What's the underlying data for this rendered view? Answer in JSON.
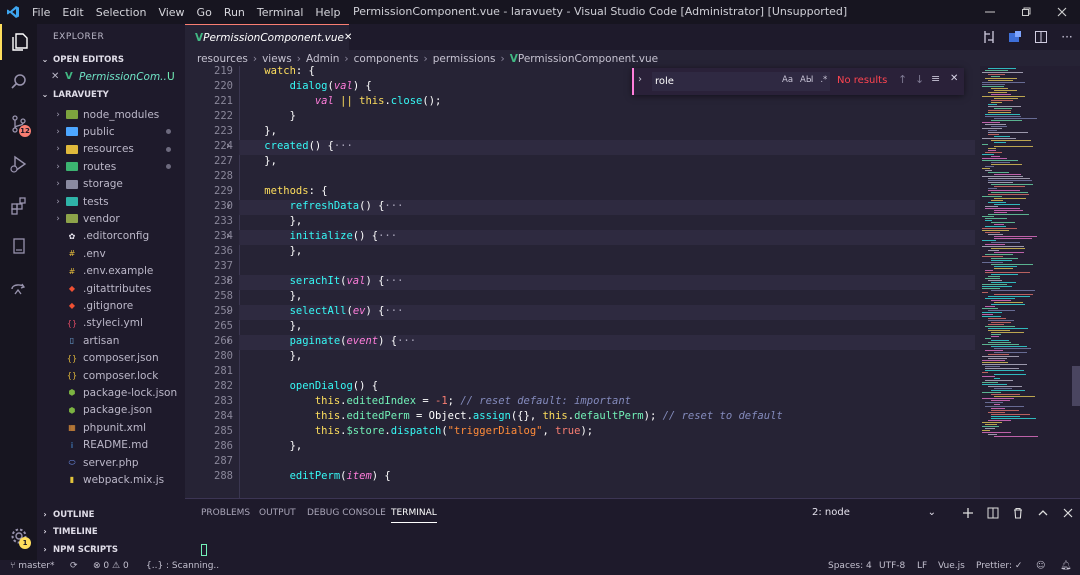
{
  "titlebar": {
    "menu": [
      "File",
      "Edit",
      "Selection",
      "View",
      "Go",
      "Run",
      "Terminal",
      "Help"
    ],
    "title": "PermissionComponent.vue - laravuety - Visual Studio Code [Administrator] [Unsupported]"
  },
  "activity": {
    "source_control_badge": "12",
    "accounts_badge": "1"
  },
  "sidebar": {
    "title": "EXPLORER",
    "open_editors_label": "OPEN EDITORS",
    "open_editor": {
      "name": "PermissionCom...",
      "status": "U"
    },
    "project_label": "LARAVUETY",
    "items": [
      {
        "name": "node_modules",
        "kind": "folder",
        "color": "#7ca33e"
      },
      {
        "name": "public",
        "kind": "folder",
        "color": "#4da6ff"
      },
      {
        "name": "resources",
        "kind": "folder",
        "color": "#e0b93c"
      },
      {
        "name": "routes",
        "kind": "folder",
        "color": "#3cb371"
      },
      {
        "name": "storage",
        "kind": "folder",
        "color": "#8a8aa0"
      },
      {
        "name": "tests",
        "kind": "folder",
        "color": "#2fb3a8"
      },
      {
        "name": "vendor",
        "kind": "folder",
        "color": "#8da34a"
      },
      {
        "name": ".editorconfig",
        "kind": "file",
        "glyph": "✿",
        "color": "#e9e6f0"
      },
      {
        "name": ".env",
        "kind": "file",
        "glyph": "#",
        "color": "#e2b93b"
      },
      {
        "name": ".env.example",
        "kind": "file",
        "glyph": "#",
        "color": "#e2b93b"
      },
      {
        "name": ".gitattributes",
        "kind": "file",
        "glyph": "◆",
        "color": "#f05033"
      },
      {
        "name": ".gitignore",
        "kind": "file",
        "glyph": "◆",
        "color": "#f05033"
      },
      {
        "name": ".styleci.yml",
        "kind": "file",
        "glyph": "{}",
        "color": "#e44c65"
      },
      {
        "name": "artisan",
        "kind": "file",
        "glyph": "▯",
        "color": "#6fa8dc"
      },
      {
        "name": "composer.json",
        "kind": "file",
        "glyph": "{}",
        "color": "#e2b93b"
      },
      {
        "name": "composer.lock",
        "kind": "file",
        "glyph": "{}",
        "color": "#e2b93b"
      },
      {
        "name": "package-lock.json",
        "kind": "file",
        "glyph": "⬢",
        "color": "#7cb342"
      },
      {
        "name": "package.json",
        "kind": "file",
        "glyph": "⬢",
        "color": "#7cb342"
      },
      {
        "name": "phpunit.xml",
        "kind": "file",
        "glyph": "▦",
        "color": "#e8963a"
      },
      {
        "name": "README.md",
        "kind": "file",
        "glyph": "i",
        "color": "#4ea1f3"
      },
      {
        "name": "server.php",
        "kind": "file",
        "glyph": "⬭",
        "color": "#6d8ee8"
      },
      {
        "name": "webpack.mix.js",
        "kind": "file",
        "glyph": "▮",
        "color": "#e2c43b"
      }
    ],
    "bottom_sections": [
      "OUTLINE",
      "TIMELINE",
      "NPM SCRIPTS"
    ]
  },
  "tab": {
    "label": "PermissionComponent.vue"
  },
  "breadcrumb": [
    "resources",
    "views",
    "Admin",
    "components",
    "permissions",
    "PermissionComponent.vue"
  ],
  "find": {
    "query": "role",
    "opt_case": "Aa",
    "opt_word": "AЫ",
    "opt_regex": ".*",
    "result": "No results"
  },
  "editor": {
    "lines": [
      {
        "n": "219",
        "tokens": [
          [
            "pt",
            "    "
          ],
          [
            "kw",
            "watch"
          ],
          [
            "pt",
            ": {"
          ]
        ]
      },
      {
        "n": "220",
        "tokens": [
          [
            "pt",
            "        "
          ],
          [
            "fn",
            "dialog"
          ],
          [
            "pt",
            "("
          ],
          [
            "pm",
            "val"
          ],
          [
            "pt",
            ") {"
          ]
        ]
      },
      {
        "n": "221",
        "tokens": [
          [
            "pt",
            "            "
          ],
          [
            "pm",
            "val"
          ],
          [
            "pt",
            " "
          ],
          [
            "kw",
            "||"
          ],
          [
            "pt",
            " "
          ],
          [
            "kw",
            "this"
          ],
          [
            "pt",
            "."
          ],
          [
            "fn",
            "close"
          ],
          [
            "pt",
            "();"
          ]
        ]
      },
      {
        "n": "222",
        "tokens": [
          [
            "pt",
            "        }"
          ]
        ]
      },
      {
        "n": "223",
        "tokens": [
          [
            "pt",
            "    },"
          ]
        ]
      },
      {
        "n": "224",
        "fold": true,
        "tokens": [
          [
            "pt",
            "    "
          ],
          [
            "fn",
            "created"
          ],
          [
            "pt",
            "() {"
          ],
          [
            "ell",
            "···"
          ]
        ]
      },
      {
        "n": "227",
        "tokens": [
          [
            "pt",
            "    },"
          ]
        ]
      },
      {
        "n": "228",
        "tokens": []
      },
      {
        "n": "229",
        "tokens": [
          [
            "pt",
            "    "
          ],
          [
            "kw",
            "methods"
          ],
          [
            "pt",
            ": {"
          ]
        ]
      },
      {
        "n": "230",
        "fold": true,
        "tokens": [
          [
            "pt",
            "        "
          ],
          [
            "fn",
            "refreshData"
          ],
          [
            "pt",
            "() {"
          ],
          [
            "ell",
            "···"
          ]
        ]
      },
      {
        "n": "233",
        "tokens": [
          [
            "pt",
            "        },"
          ]
        ]
      },
      {
        "n": "234",
        "fold": true,
        "tokens": [
          [
            "pt",
            "        "
          ],
          [
            "fn",
            "initialize"
          ],
          [
            "pt",
            "() {"
          ],
          [
            "ell",
            "···"
          ]
        ]
      },
      {
        "n": "236",
        "tokens": [
          [
            "pt",
            "        },"
          ]
        ]
      },
      {
        "n": "237",
        "tokens": []
      },
      {
        "n": "238",
        "fold": true,
        "tokens": [
          [
            "pt",
            "        "
          ],
          [
            "fn",
            "serachIt"
          ],
          [
            "pt",
            "("
          ],
          [
            "pm",
            "val"
          ],
          [
            "pt",
            ") {"
          ],
          [
            "ell",
            "···"
          ]
        ]
      },
      {
        "n": "258",
        "tokens": [
          [
            "pt",
            "        },"
          ]
        ]
      },
      {
        "n": "259",
        "fold": true,
        "tokens": [
          [
            "pt",
            "        "
          ],
          [
            "fn",
            "selectAll"
          ],
          [
            "pt",
            "("
          ],
          [
            "pm",
            "ev"
          ],
          [
            "pt",
            ") {"
          ],
          [
            "ell",
            "···"
          ]
        ]
      },
      {
        "n": "265",
        "tokens": [
          [
            "pt",
            "        },"
          ]
        ]
      },
      {
        "n": "266",
        "fold": true,
        "tokens": [
          [
            "pt",
            "        "
          ],
          [
            "fn",
            "paginate"
          ],
          [
            "pt",
            "("
          ],
          [
            "pm",
            "event"
          ],
          [
            "pt",
            ") {"
          ],
          [
            "ell",
            "···"
          ]
        ]
      },
      {
        "n": "280",
        "tokens": [
          [
            "pt",
            "        },"
          ]
        ]
      },
      {
        "n": "281",
        "tokens": []
      },
      {
        "n": "282",
        "tokens": [
          [
            "pt",
            "        "
          ],
          [
            "fn",
            "openDialog"
          ],
          [
            "pt",
            "() {"
          ]
        ]
      },
      {
        "n": "283",
        "tokens": [
          [
            "pt",
            "            "
          ],
          [
            "kw",
            "this"
          ],
          [
            "pt",
            "."
          ],
          [
            "pr",
            "editedIndex"
          ],
          [
            "pt",
            " = "
          ],
          [
            "lit",
            "-1"
          ],
          [
            "pt",
            "; "
          ],
          [
            "cm",
            "// reset default: important"
          ]
        ]
      },
      {
        "n": "284",
        "tokens": [
          [
            "pt",
            "            "
          ],
          [
            "kw",
            "this"
          ],
          [
            "pt",
            "."
          ],
          [
            "pr",
            "editedPerm"
          ],
          [
            "pt",
            " = Object."
          ],
          [
            "fn",
            "assign"
          ],
          [
            "pt",
            "({}, "
          ],
          [
            "kw",
            "this"
          ],
          [
            "pt",
            "."
          ],
          [
            "pr",
            "defaultPerm"
          ],
          [
            "pt",
            "); "
          ],
          [
            "cm",
            "// reset to default"
          ]
        ]
      },
      {
        "n": "285",
        "tokens": [
          [
            "pt",
            "            "
          ],
          [
            "kw",
            "this"
          ],
          [
            "pt",
            "."
          ],
          [
            "pr",
            "$store"
          ],
          [
            "pt",
            "."
          ],
          [
            "fn",
            "dispatch"
          ],
          [
            "pt",
            "("
          ],
          [
            "st",
            "\"triggerDialog\""
          ],
          [
            "pt",
            ", "
          ],
          [
            "lit",
            "true"
          ],
          [
            "pt",
            ");"
          ]
        ]
      },
      {
        "n": "286",
        "tokens": [
          [
            "pt",
            "        },"
          ]
        ]
      },
      {
        "n": "287",
        "tokens": []
      },
      {
        "n": "288",
        "tokens": [
          [
            "pt",
            "        "
          ],
          [
            "fn",
            "editPerm"
          ],
          [
            "pt",
            "("
          ],
          [
            "pm",
            "item"
          ],
          [
            "pt",
            ") {"
          ]
        ]
      }
    ]
  },
  "panel": {
    "tabs": [
      "PROBLEMS",
      "OUTPUT",
      "DEBUG CONSOLE",
      "TERMINAL"
    ],
    "active_tab": "TERMINAL",
    "terminal_select": "2: node"
  },
  "status": {
    "branch": "master*",
    "errors": "0",
    "warnings": "0",
    "scanning": "{..} : Scanning..",
    "spaces": "Spaces: 4",
    "encoding": "UTF-8",
    "eol": "LF",
    "language": "Vue.js",
    "prettier": "Prettier: ✓"
  },
  "colors": {
    "accent": "#f97e72",
    "find_border": "#ff7edb",
    "no_results": "#fe4450"
  }
}
